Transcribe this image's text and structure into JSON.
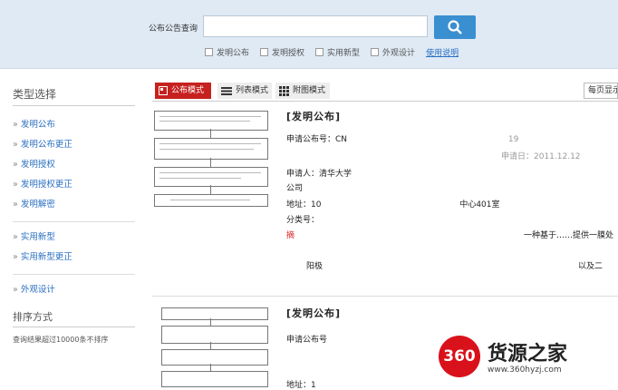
{
  "search": {
    "label": "公布公告查询",
    "input_value": "",
    "options": [
      "发明公布",
      "发明授权",
      "实用新型",
      "外观设计"
    ],
    "help_link": "使用说明"
  },
  "sidebar": {
    "title": "类型选择",
    "group1": [
      "发明公布",
      "发明公布更正",
      "发明授权",
      "发明授权更正",
      "发明解密"
    ],
    "group2": [
      "实用新型",
      "实用新型更正"
    ],
    "group3": [
      "外观设计"
    ],
    "sort_title": "排序方式",
    "sort_note": "查询结果超过10000条不排序"
  },
  "viewbar": {
    "tabs": [
      "公布模式",
      "列表模式",
      "附图模式"
    ],
    "per_page": "每页显示"
  },
  "results": [
    {
      "title": "[发明公布]",
      "app_pub_no_label": "申请公布号：CN",
      "app_pub_no_suffix": "19",
      "date_label": "申请日：2011.12.12",
      "applicant": "申请人：清华大学",
      "company": "公司",
      "address_label": "地址：10",
      "address_suffix": "中心401室",
      "class_label": "分类号：",
      "line_a": "一种基于……提供一膜处",
      "line_b": "阳极",
      "line_c": "以及二"
    },
    {
      "title": "[发明公布]",
      "app_pub_no_label": "申请公布号",
      "address_label": "地址：1"
    }
  ],
  "watermark": {
    "number": "360",
    "text": "货源之家",
    "url": "www.360hyzj.com"
  },
  "colors": {
    "accent_red": "#c6211f",
    "search_button": "#3a8fd0",
    "top_bg": "#dfeaf5",
    "link_blue": "#2a6fc2"
  }
}
